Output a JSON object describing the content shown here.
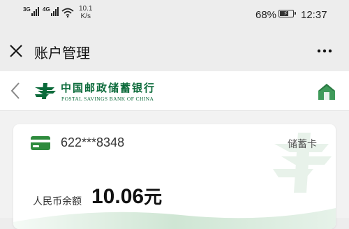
{
  "status_bar": {
    "signal1_label": "3G",
    "signal2_label": "4G",
    "net_speed_value": "10.1",
    "net_speed_unit": "K/s",
    "battery_percent": "68%",
    "battery_level": 0.68,
    "time": "12:37"
  },
  "title_bar": {
    "title": "账户管理",
    "close_icon": "close-icon",
    "more_icon": "more-icon"
  },
  "bank_header": {
    "name_cn": "中国邮政储蓄银行",
    "name_en": "POSTAL SAVINGS BANK OF CHINA",
    "back_icon": "chevron-left-icon",
    "home_icon": "home-icon",
    "brand_color": "#0b6a3a"
  },
  "account": {
    "card_number": "622***8348",
    "card_type": "储蓄卡",
    "balance_label": "人民币余额",
    "balance_value": "10.06",
    "balance_unit": "元",
    "card_icon": "bank-card-icon",
    "accent_color": "#2e8b3d"
  }
}
